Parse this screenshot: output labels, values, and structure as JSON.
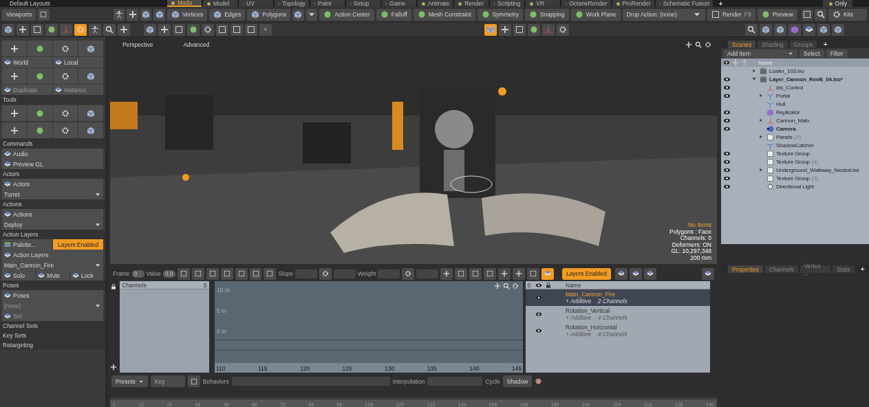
{
  "title_bar": {
    "layout": "Default Layouts",
    "tabs": [
      {
        "label": "Modo",
        "starred": true,
        "selected": true
      },
      {
        "label": "Model",
        "starred": true,
        "selected": false
      },
      {
        "label": "UV",
        "starred": false,
        "selected": false
      },
      {
        "label": "Topology",
        "starred": false,
        "selected": false
      },
      {
        "label": "Paint",
        "starred": false,
        "selected": false
      },
      {
        "label": "Setup",
        "starred": false,
        "selected": false
      },
      {
        "label": "Game",
        "starred": false,
        "selected": false
      },
      {
        "label": "Animate",
        "starred": true,
        "selected": false
      },
      {
        "label": "Render",
        "starred": true,
        "selected": false
      },
      {
        "label": "Scripting",
        "starred": false,
        "selected": false
      },
      {
        "label": "VR",
        "starred": true,
        "selected": false
      },
      {
        "label": "OctaneRender",
        "starred": false,
        "selected": false
      },
      {
        "label": "ProRender",
        "starred": true,
        "selected": false
      },
      {
        "label": "Schematic Fusion",
        "starred": false,
        "selected": false
      }
    ],
    "add": "+",
    "only": "Only"
  },
  "toolbar": {
    "viewports": "Viewports",
    "modes": [
      "Vertices",
      "Edges",
      "Polygons"
    ],
    "tools": [
      "Action Center",
      "Falloff",
      "Mesh Constraint",
      "Symmetry",
      "Snapping",
      "Work Plane"
    ],
    "drop_action": "Drop Action: (none)",
    "render": "Render",
    "render_shortcut": "F9",
    "preview": "Preview",
    "kits": "Kits",
    "add": "+"
  },
  "left_panel": {
    "rows": [
      {
        "kind": "icons"
      },
      {
        "kind": "buttons",
        "items": [
          {
            "label": "World",
            "disabled": false
          },
          {
            "label": "Local",
            "disabled": false
          }
        ]
      },
      {
        "kind": "icons"
      },
      {
        "kind": "buttons",
        "items": [
          {
            "label": "Duplicate",
            "disabled": true
          },
          {
            "label": "Instance",
            "disabled": true
          }
        ]
      },
      {
        "kind": "header",
        "label": "Tools"
      },
      {
        "kind": "icons"
      },
      {
        "kind": "icons"
      },
      {
        "kind": "header",
        "label": "Commands"
      },
      {
        "kind": "buttons",
        "items": [
          {
            "label": "Audio",
            "disabled": false
          }
        ]
      },
      {
        "kind": "buttons",
        "items": [
          {
            "label": "Preview GL",
            "disabled": false
          }
        ]
      },
      {
        "kind": "header",
        "label": "Actors"
      },
      {
        "kind": "buttons",
        "items": [
          {
            "label": "Actors",
            "disabled": false
          }
        ]
      },
      {
        "kind": "dropdown",
        "value": "Turret",
        "disabled": false
      },
      {
        "kind": "header",
        "label": "Actions"
      },
      {
        "kind": "buttons",
        "items": [
          {
            "label": "Actions",
            "disabled": false
          }
        ]
      },
      {
        "kind": "dropdown",
        "value": "Deploy",
        "disabled": false
      },
      {
        "kind": "header",
        "label": "Action Layers"
      },
      {
        "kind": "toggle",
        "label": "Palette...",
        "toggle": "Layers Enabled",
        "on": true
      },
      {
        "kind": "buttons",
        "items": [
          {
            "label": "Action Layers",
            "disabled": false
          }
        ]
      },
      {
        "kind": "dropdown",
        "value": "Main_Cannon_Fire",
        "disabled": false
      },
      {
        "kind": "buttons",
        "items": [
          {
            "label": "Solo",
            "disabled": false
          },
          {
            "label": "Mute",
            "disabled": false
          },
          {
            "label": "Lock",
            "disabled": false
          }
        ]
      },
      {
        "kind": "header",
        "label": "Poses"
      },
      {
        "kind": "buttons",
        "items": [
          {
            "label": "Poses",
            "disabled": false
          }
        ]
      },
      {
        "kind": "dropdown",
        "value": "(none)",
        "disabled": true
      },
      {
        "kind": "buttons",
        "items": [
          {
            "label": "Set",
            "disabled": true
          }
        ]
      },
      {
        "kind": "header",
        "label": "Channel Sets"
      },
      {
        "kind": "header",
        "label": "Key Sets"
      },
      {
        "kind": "header",
        "label": "Retargeting"
      }
    ]
  },
  "viewport": {
    "view": "Perspective",
    "style": "Advanced",
    "info": [
      {
        "text": "No Items",
        "kind": "highlight"
      },
      {
        "text": "Polygons : Face",
        "kind": "plain"
      },
      {
        "text": "Channels: 0",
        "kind": "plain"
      },
      {
        "text": "Deformers: ON",
        "kind": "plain"
      },
      {
        "text": "GL: 10,297,348",
        "kind": "plain"
      },
      {
        "text": "200 mm",
        "kind": "plain"
      }
    ]
  },
  "graph": {
    "frame_label": "Frame",
    "frame": "0",
    "value_label": "Value",
    "value": "0.0",
    "slope_label": "Slope",
    "weight_label": "Weight",
    "channels_header": "Channels",
    "channels_s": "S",
    "y_labels": [
      "10 m",
      "5 m",
      "0 m"
    ],
    "x_labels": [
      "110",
      "115",
      "120",
      "125",
      "130",
      "135",
      "140",
      "146"
    ]
  },
  "layers": {
    "layers_enabled": {
      "label": "Layers Enabled",
      "on": true
    },
    "s_header": "S",
    "name_header": "Name",
    "items": [
      {
        "name": "Main_Cannon_Fire",
        "mode": "+ Additive",
        "channels": "2 Channels",
        "visible": true,
        "selected": true
      },
      {
        "name": "Rotation_Vertical",
        "mode": "+ Additive",
        "channels": "4 Channels",
        "visible": true,
        "selected": false
      },
      {
        "name": "Rotation_Horizontal",
        "mode": "+ Additive",
        "channels": "4 Channels",
        "visible": true,
        "selected": false
      }
    ]
  },
  "options": {
    "presets": "Presets",
    "key": "Key",
    "behaviors": "Behaviors",
    "interpolation": "Interpolation",
    "cycle": "Cycle",
    "shadow": "Shadow"
  },
  "ruler": {
    "ticks": [
      "0",
      "12",
      "24",
      "36",
      "48",
      "60",
      "72",
      "84",
      "96",
      "108",
      "120",
      "132",
      "144",
      "156",
      "168",
      "180",
      "192",
      "204",
      "216",
      "228",
      "240"
    ]
  },
  "scenes": {
    "tabs": [
      {
        "label": "Scenes",
        "selected": true
      },
      {
        "label": "Shading",
        "selected": false
      },
      {
        "label": "Groups",
        "selected": false
      }
    ],
    "add": "+",
    "add_item": "Add Item",
    "select": "Select",
    "filter": "Filter",
    "name_header": "Name",
    "items": [
      {
        "name": "Loafer_103.lxo",
        "kind": "scene",
        "visible": false,
        "active": false,
        "expanded": false
      },
      {
        "name": "Layer_Cannon_RevB_04.lxo*",
        "kind": "scene",
        "visible": true,
        "active": true,
        "expanded": true,
        "children": [
          {
            "name": "Iris_Control",
            "kind": "locator",
            "visible": true,
            "active": false
          },
          {
            "name": "Portal",
            "kind": "mesh",
            "visible": true,
            "active": false,
            "expanded": false
          },
          {
            "name": "Hull",
            "kind": "mesh",
            "visible": false,
            "active": false
          },
          {
            "name": "Replicator",
            "kind": "replicator",
            "visible": true,
            "active": false
          },
          {
            "name": "Cannon_Main",
            "kind": "locator",
            "visible": true,
            "active": false,
            "expanded": false
          },
          {
            "name": "Camera",
            "kind": "camera",
            "visible": true,
            "active": true
          },
          {
            "name": "Panels",
            "count": "(2)",
            "kind": "group",
            "visible": false,
            "active": false,
            "expanded": false
          },
          {
            "name": "ShadowCatcher",
            "kind": "mesh",
            "visible": false,
            "active": false
          },
          {
            "name": "Texture Group",
            "kind": "group",
            "visible": true,
            "active": false
          },
          {
            "name": "Texture Group",
            "count": "(4)",
            "kind": "group",
            "visible": true,
            "active": false
          },
          {
            "name": "Underground_Walkway_Neutral.lxe",
            "kind": "group",
            "visible": true,
            "active": false,
            "expanded": false
          },
          {
            "name": "Texture Group",
            "count": "(3)",
            "kind": "group",
            "visible": true,
            "active": false
          },
          {
            "name": "Directional Light",
            "kind": "light",
            "visible": true,
            "active": false
          }
        ]
      }
    ]
  },
  "properties": {
    "tabs": [
      {
        "label": "Properties",
        "selected": true
      },
      {
        "label": "Channels",
        "selected": false
      },
      {
        "label": "Vertex ...",
        "selected": false
      },
      {
        "label": "Stats",
        "selected": false
      }
    ],
    "add": "+"
  }
}
